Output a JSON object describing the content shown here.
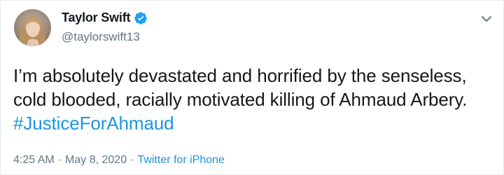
{
  "author": {
    "display_name": "Taylor Swift",
    "handle": "@taylorswift13",
    "verified": true
  },
  "tweet": {
    "text": "I’m absolutely devastated and horrified by the senseless, cold blooded, racially motivated killing of Ahmaud Arbery. ",
    "hashtag": "#JusticeForAhmaud"
  },
  "meta": {
    "time": "4:25 AM",
    "separator": "·",
    "date": "May 8, 2020",
    "source": "Twitter for iPhone"
  },
  "colors": {
    "link": "#1b95e0",
    "secondary_text": "#657786",
    "verified_badge": "#1da1f2"
  },
  "icons": {
    "verified": "verified-badge-icon",
    "more": "chevron-down-icon"
  }
}
